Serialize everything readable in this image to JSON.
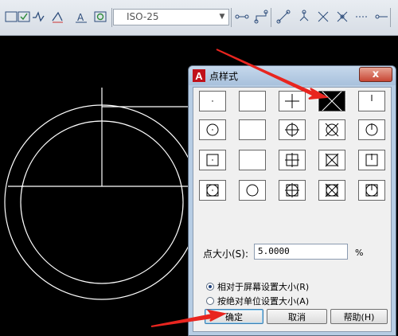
{
  "toolbar": {
    "dimstyle_value": "ISO-25",
    "icons": [
      "dim-linear-icon",
      "dim-aligned-icon",
      "dim-arc-icon",
      "dim-ordinate-icon",
      "dim-radius-icon",
      "dim-jogged-icon",
      "dim-diameter-icon",
      "dim-angular-icon",
      "quick-dim-icon",
      "baseline-icon",
      "continue-icon",
      "dim-space-icon",
      "dim-break-icon",
      "tolerance-icon",
      "center-mark-icon",
      "inspect-icon",
      "jog-linear-icon",
      "dim-edit-icon"
    ]
  },
  "dialog": {
    "title": "点样式",
    "close_label": "x",
    "app_icon": "A",
    "styles": [
      [
        "dot",
        "empty",
        "plus",
        "cross",
        "tick"
      ],
      [
        "circle-dot",
        "circle",
        "circle-plus",
        "circle-cross",
        "circle-tick"
      ],
      [
        "square-dot",
        "square",
        "square-plus",
        "square-cross",
        "square-tick"
      ],
      [
        "circle-square-dot",
        "circle-square",
        "circle-square-plus",
        "circle-square-cross",
        "circle-square-tick"
      ]
    ],
    "selected": "cross",
    "size_label": "点大小(S):",
    "size_value": "5.0000",
    "size_unit": "%",
    "radio_relative": "相对于屏幕设置大小(R)",
    "radio_absolute": "按绝对单位设置大小(A)",
    "radio_selected": "relative",
    "ok_label": "确定",
    "cancel_label": "取消",
    "help_label": "帮助(H)"
  },
  "colors": {
    "arrow": "#e8251f",
    "canvas_bg": "#000000",
    "drawing_lines": "#ffffff"
  }
}
